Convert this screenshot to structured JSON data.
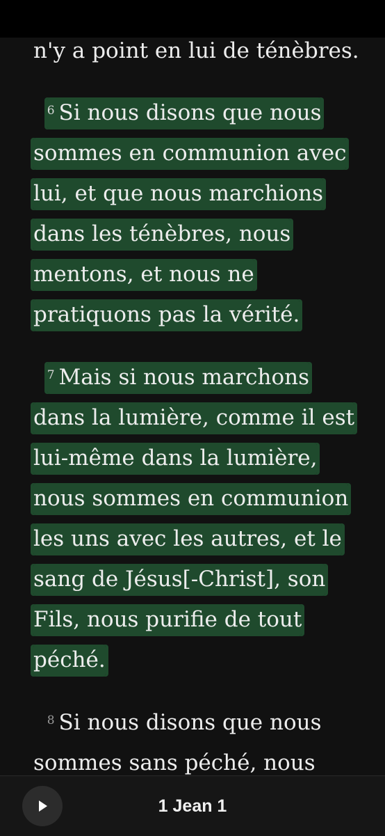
{
  "reader": {
    "partial_top": "n'y a point en lui de ténèbres.",
    "verses": [
      {
        "number": "6",
        "text": "Si nous disons que nous sommes en communion avec lui, et que nous marchions dans les ténèbres, nous mentons, et nous ne pratiquons pas la vérité.",
        "highlighted": true
      },
      {
        "number": "7",
        "text": "Mais si nous marchons dans la lumière, comme il est lui-même dans la lumière, nous sommes en communion les uns avec les autres, et le sang de Jésus[-Christ], son Fils, nous purifie de tout péché.",
        "highlighted": true
      },
      {
        "number": "8",
        "text": "Si nous disons que nous sommes sans péché, nous",
        "highlighted": false
      }
    ],
    "highlight_color": "#1f4a2d"
  },
  "player": {
    "play_icon": "play-icon",
    "chapter_title": "1 Jean 1"
  }
}
